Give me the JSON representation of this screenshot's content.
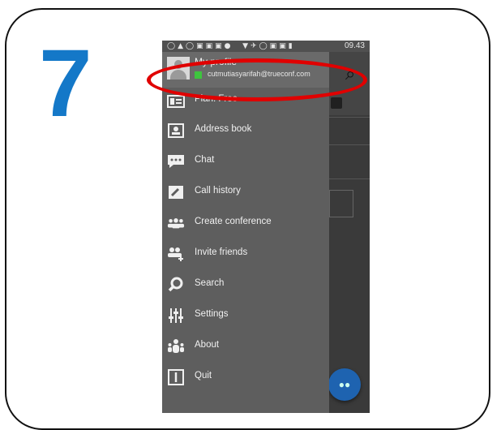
{
  "step": {
    "number": "7",
    "color": "#1478c8"
  },
  "status_bar": {
    "time": "09.43"
  },
  "profile": {
    "name": "My profile",
    "email": "cutmutiasyarifah@trueconf.com",
    "presence_color": "#3ec43e"
  },
  "plan": {
    "label": "Plan: Free"
  },
  "menu": [
    {
      "label": "Address book",
      "icon": "address-book-icon"
    },
    {
      "label": "Chat",
      "icon": "chat-icon"
    },
    {
      "label": "Call history",
      "icon": "call-history-icon"
    },
    {
      "label": "Create conference",
      "icon": "conference-icon"
    },
    {
      "label": "Invite friends",
      "icon": "invite-friends-icon"
    },
    {
      "label": "Search",
      "icon": "search-icon"
    },
    {
      "label": "Settings",
      "icon": "settings-icon"
    },
    {
      "label": "About",
      "icon": "about-icon"
    },
    {
      "label": "Quit",
      "icon": "quit-icon"
    }
  ],
  "annotation": {
    "color": "#e00000"
  }
}
